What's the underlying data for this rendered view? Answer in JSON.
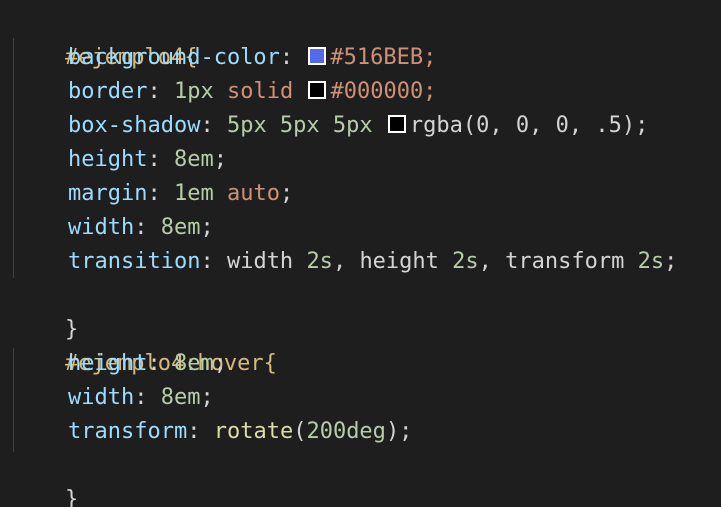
{
  "colors": {
    "background": "#1e1e1e",
    "selector": "#d7ba7d",
    "property": "#9cdcfe",
    "number": "#b5cea8",
    "keyword": "#ce9178",
    "swatch_blue": "#516BEB",
    "swatch_black": "#000000",
    "swatch_shadow": "rgba(0, 0, 0, .5)"
  },
  "code": {
    "rule1_selector": "#ejemplo4{",
    "bg_prop": "background-color",
    "bg_value": "#516BEB;",
    "border_prop": "border",
    "border_width": "1px",
    "border_style": "solid",
    "border_color": "#000000;",
    "shadow_prop": "box-shadow",
    "shadow_offsets": "5px 5px 5px",
    "shadow_value": "rgba(0, 0, 0, .5);",
    "height_prop": "height",
    "height_value": "8em",
    "margin_prop": "margin",
    "margin_value": "1em",
    "margin_auto": "auto",
    "width_prop": "width",
    "width_value": "8em",
    "transition_prop": "transition",
    "transition_width": "width",
    "transition_dur1": "2s",
    "transition_height": "height",
    "transition_dur2": "2s",
    "transition_transform": "transform",
    "transition_dur3": "2s",
    "close1": "}",
    "rule2_selector": "#ejemplo4:hover{",
    "hover_height_prop": "height",
    "hover_height_value": "8em",
    "hover_width_prop": "width",
    "hover_width_value": "8em",
    "hover_transform_prop": "transform",
    "hover_transform_fn": "rotate",
    "hover_transform_arg": "200deg",
    "close2": "}"
  }
}
